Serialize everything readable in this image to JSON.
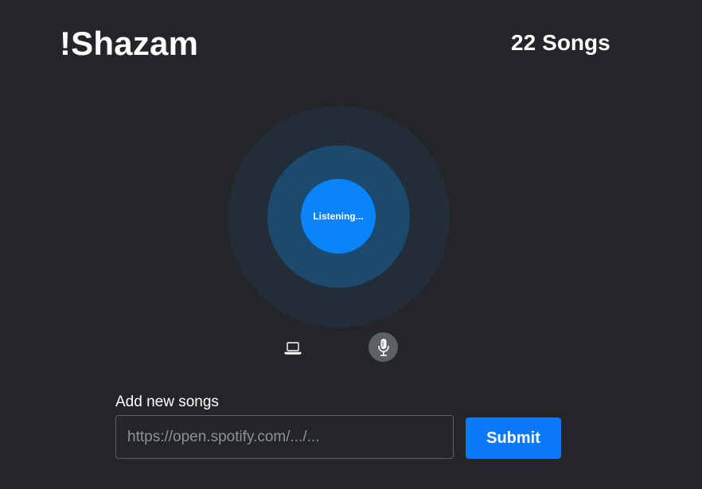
{
  "header": {
    "title": "!Shazam",
    "song_count": "22",
    "song_count_label": "Songs"
  },
  "listener": {
    "status": "Listening..."
  },
  "source_toggle": {
    "device_icon": "laptop-icon",
    "mic_icon": "microphone-icon",
    "selected": "microphone"
  },
  "add_songs": {
    "label": "Add new songs",
    "input_value": "",
    "input_placeholder": "https://open.spotify.com/.../...",
    "submit_label": "Submit"
  },
  "colors": {
    "background": "#232528",
    "accent": "#0a84fb",
    "ring_outer": "#222d38",
    "ring_middle": "#1c4a6f",
    "toggle_active": "#5d6166"
  }
}
